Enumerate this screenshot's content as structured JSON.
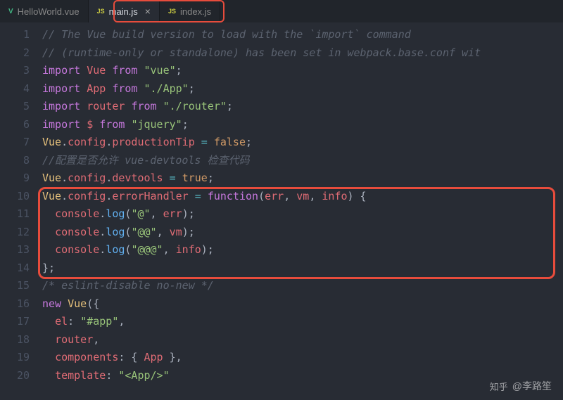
{
  "tabs": [
    {
      "icon": "V",
      "iconClass": "vue",
      "label": "HelloWorld.vue",
      "active": false,
      "close": false
    },
    {
      "icon": "JS",
      "iconClass": "js",
      "label": "main.js",
      "active": true,
      "close": true
    },
    {
      "icon": "JS",
      "iconClass": "js",
      "label": "index.js",
      "active": false,
      "close": false
    }
  ],
  "lineNumbers": [
    "1",
    "2",
    "3",
    "4",
    "5",
    "6",
    "7",
    "8",
    "9",
    "10",
    "11",
    "12",
    "13",
    "14",
    "15",
    "16",
    "17",
    "18",
    "19",
    "20"
  ],
  "code": {
    "l1": {
      "c1": "// The Vue build version to load with the `import` command"
    },
    "l2": {
      "c1": "// (runtime-only or standalone) has been set in webpack.base.conf wit"
    },
    "l3": {
      "kw": "import",
      "vr": "Vue",
      "fr": "from",
      "st": "\"vue\"",
      "sc": ";"
    },
    "l4": {
      "kw": "import",
      "vr": "App",
      "fr": "from",
      "st": "\"./App\"",
      "sc": ";"
    },
    "l5": {
      "kw": "import",
      "vr": "router",
      "fr": "from",
      "st": "\"./router\"",
      "sc": ";"
    },
    "l6": {
      "kw": "import",
      "vr": "$",
      "fr": "from",
      "st": "\"jquery\"",
      "sc": ";"
    },
    "l7": {
      "obj": "Vue",
      "d1": ".",
      "p1": "config",
      "d2": ".",
      "p2": "productionTip",
      "eq": " = ",
      "val": "false",
      "sc": ";"
    },
    "l8": {
      "c1": "//配置是否允许 vue-devtools 检查代码"
    },
    "l9": {
      "obj": "Vue",
      "d1": ".",
      "p1": "config",
      "d2": ".",
      "p2": "devtools",
      "eq": " = ",
      "val": "true",
      "sc": ";"
    },
    "l10": {
      "obj": "Vue",
      "d1": ".",
      "p1": "config",
      "d2": ".",
      "p2": "errorHandler",
      "eq": " = ",
      "fn": "function",
      "op": "(",
      "a1": "err",
      "c1": ", ",
      "a2": "vm",
      "c2": ", ",
      "a3": "info",
      "cp": ") {"
    },
    "l11": {
      "ind": "  ",
      "obj": "console",
      "d": ".",
      "fn": "log",
      "op": "(",
      "st": "\"@\"",
      "c": ", ",
      "vr": "err",
      "cp": ");"
    },
    "l12": {
      "ind": "  ",
      "obj": "console",
      "d": ".",
      "fn": "log",
      "op": "(",
      "st": "\"@@\"",
      "c": ", ",
      "vr": "vm",
      "cp": ");"
    },
    "l13": {
      "ind": "  ",
      "obj": "console",
      "d": ".",
      "fn": "log",
      "op": "(",
      "st": "\"@@@\"",
      "c": ", ",
      "vr": "info",
      "cp": ");"
    },
    "l14": {
      "t": "};"
    },
    "l15": {
      "c1": "/* eslint-disable no-new */"
    },
    "l16": {
      "kw": "new",
      "sp": " ",
      "cls": "Vue",
      "op": "({"
    },
    "l17": {
      "ind": "  ",
      "pr": "el",
      "co": ": ",
      "st": "\"#app\"",
      "c": ","
    },
    "l18": {
      "ind": "  ",
      "pr": "router",
      "c": ","
    },
    "l19": {
      "ind": "  ",
      "pr": "components",
      "co": ": { ",
      "vr": "App",
      "cp": " },"
    },
    "l20": {
      "ind": "  ",
      "pr": "template",
      "co": ": ",
      "st": "\"<App/>\""
    }
  },
  "watermark": {
    "prefix": "知乎",
    "author": "@李路笙"
  }
}
